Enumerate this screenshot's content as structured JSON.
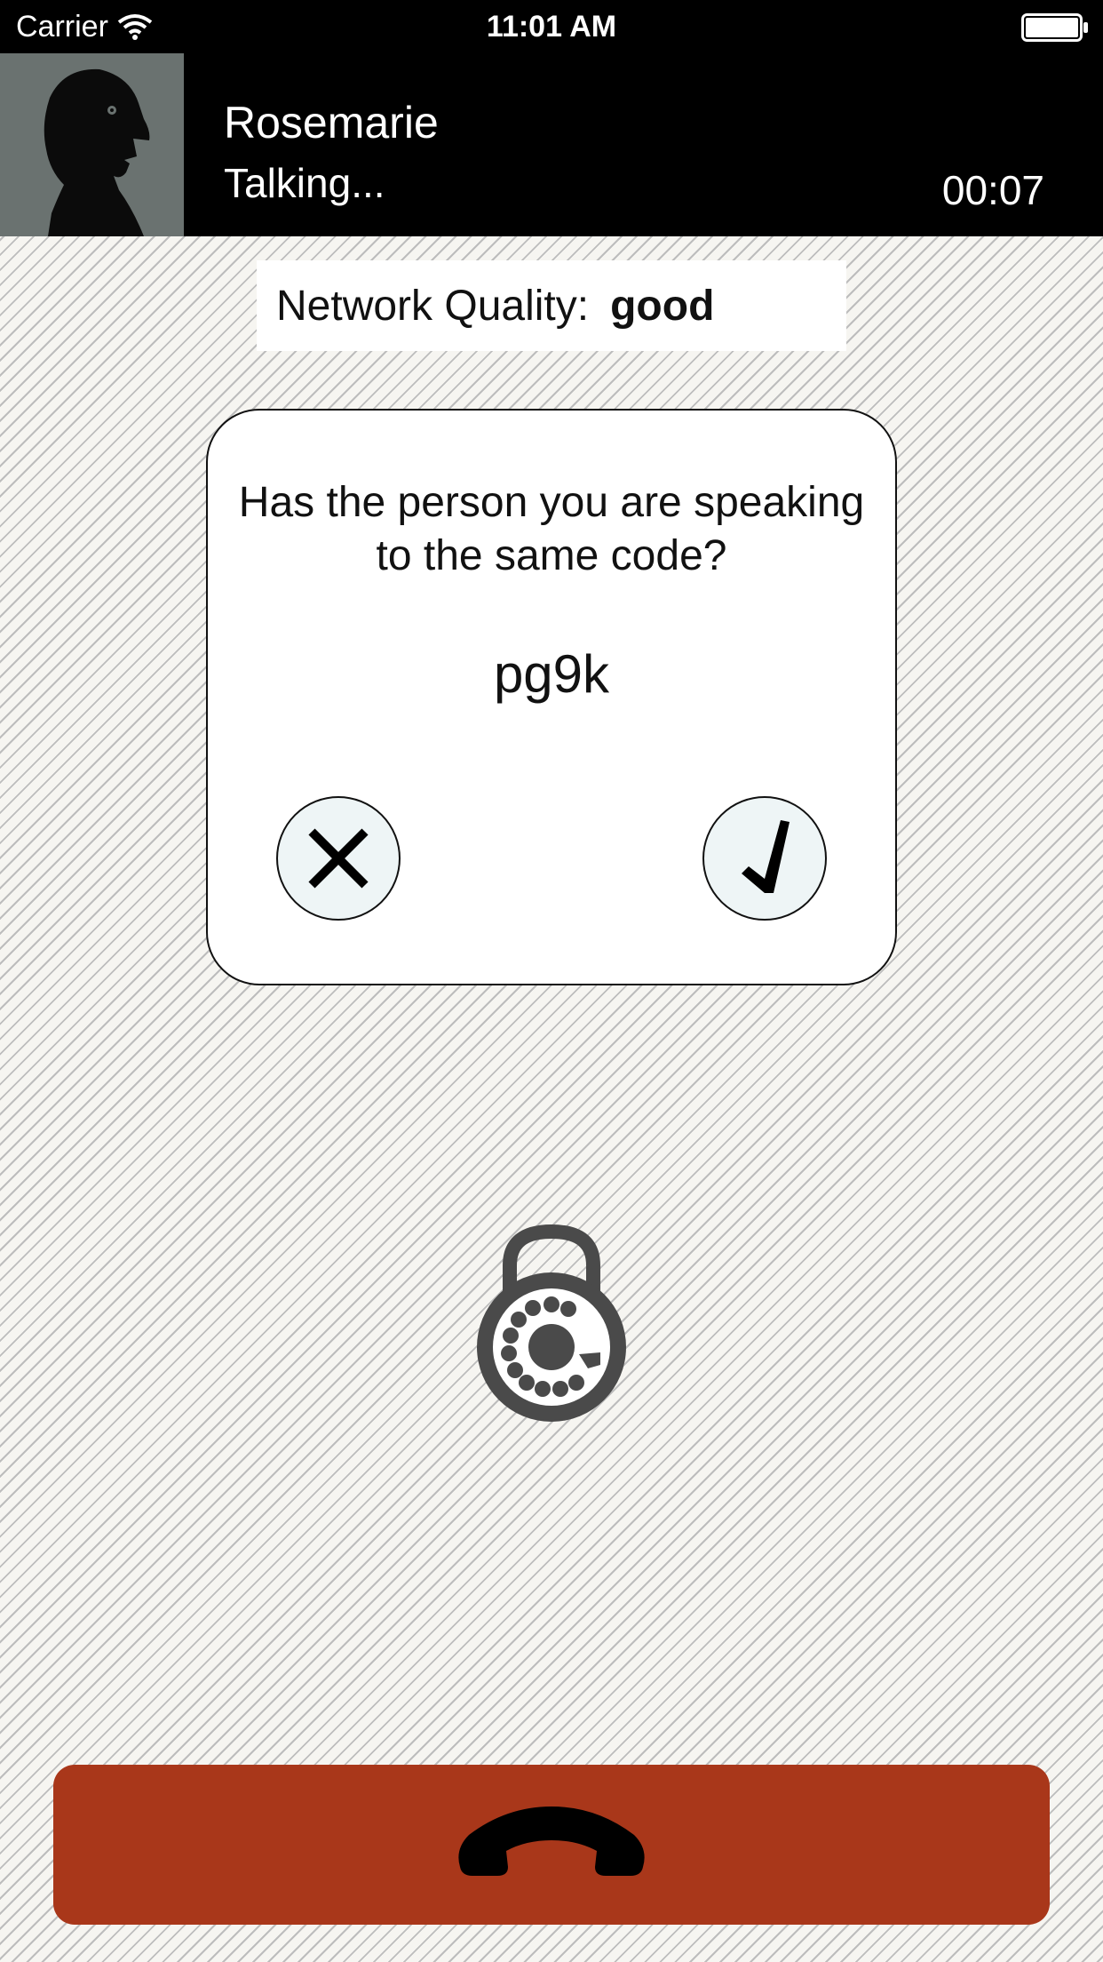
{
  "status_bar": {
    "carrier": "Carrier",
    "time": "11:01 AM",
    "wifi_icon": "wifi-icon",
    "battery_icon": "battery-icon"
  },
  "call": {
    "contact_name": "Rosemarie",
    "status": "Talking...",
    "duration": "00:07",
    "avatar_icon": "person-silhouette-icon"
  },
  "network": {
    "label": "Network Quality:",
    "value": "good"
  },
  "verification": {
    "question": "Has the person you are speaking to the same code?",
    "code": "pg9k",
    "reject_icon": "x-icon",
    "confirm_icon": "checkmark-icon"
  },
  "security": {
    "icon": "rotary-lock-icon"
  },
  "hangup": {
    "icon": "phone-hangup-icon"
  },
  "colors": {
    "header_background": "#000000",
    "avatar_background": "#6a7270",
    "hangup_button": "#a9371a",
    "icon_gray": "#4a4a4a",
    "round_button_fill": "#eef5f6"
  }
}
